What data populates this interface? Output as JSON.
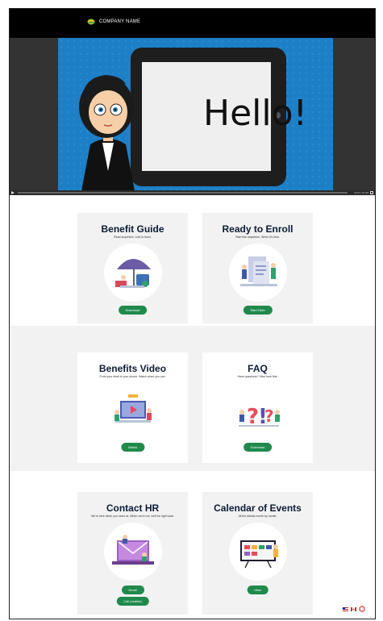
{
  "header": {
    "company_name": "COMPANY NAME"
  },
  "video": {
    "hello_text": "Hello!",
    "time": "00:01 / 01:35"
  },
  "cards": [
    {
      "title": "Benefit Guide",
      "subtitle": "Read anywhere. Lots to learn.",
      "buttons": [
        "Download"
      ],
      "icon": "umbrella-illustration"
    },
    {
      "title": "Ready to Enroll",
      "subtitle": "Start this anywhere. When it's time.",
      "buttons": [
        "Start Here"
      ],
      "icon": "form-illustration"
    },
    {
      "title": "Benefits Video",
      "subtitle": "From your desk to your phone. Watch when you can.",
      "buttons": [
        "Watch"
      ],
      "icon": "video-illustration"
    },
    {
      "title": "FAQ",
      "subtitle": "Have questions? Start here first.",
      "buttons": [
        "Download"
      ],
      "icon": "question-illustration"
    },
    {
      "title": "Contact HR",
      "subtitle": "We're here when you need us. When we're not, we'll be right back.",
      "buttons": [
        "Email",
        "Call (mobile)"
      ],
      "icon": "laptop-mail-illustration"
    },
    {
      "title": "Calendar of Events",
      "subtitle": "All the details month by month.",
      "buttons": [
        "View"
      ],
      "icon": "calendar-illustration"
    }
  ],
  "colors": {
    "header_bg": "#000000",
    "video_blue": "#1d7fc6",
    "button_green": "#1f8a4c",
    "title_navy": "#0c1b36",
    "card_bg": "#f2f2f2",
    "band_alt_bg": "#f2f2f2"
  }
}
